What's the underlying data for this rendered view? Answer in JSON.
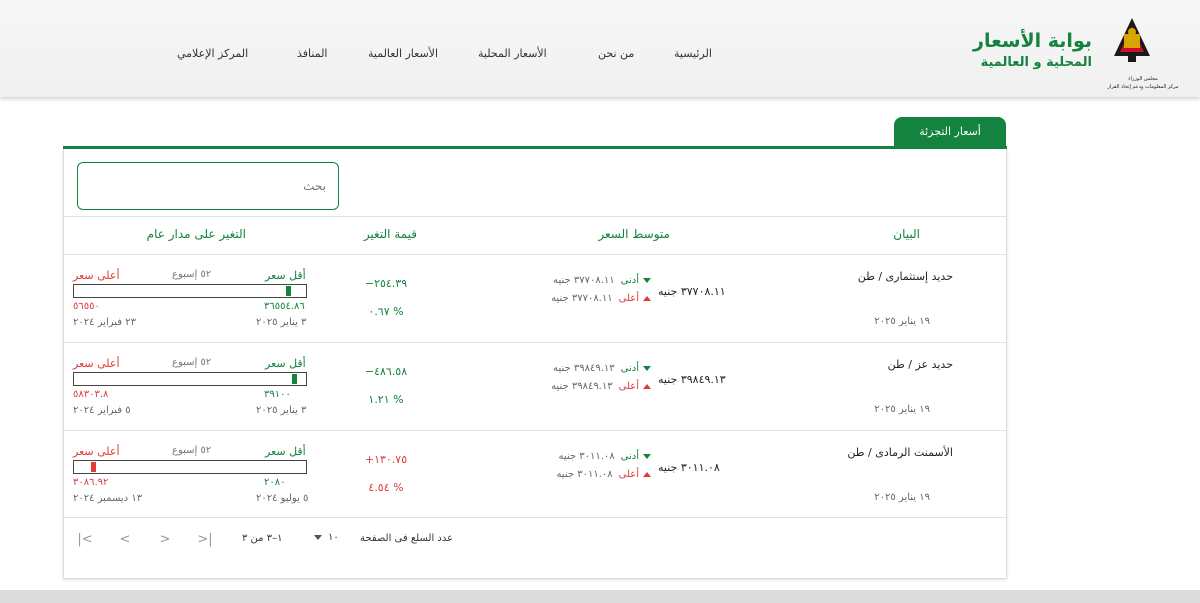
{
  "header": {
    "portal_title": "بوابة الأسعار",
    "portal_subtitle": "المحلية و العالمية",
    "logo_caption_line1": "مجلس الوزراء",
    "logo_caption_line2": "مركز المعلومات ودعم إتخاذ القرار",
    "nav": [
      "الرئيسية",
      "من نحن",
      "الأسعار المحلية",
      "الأسعار العالمية",
      "المنافذ",
      "المركز الإعلامي"
    ]
  },
  "tab": {
    "label": "أسعار التجزئة"
  },
  "search": {
    "placeholder": "بحث"
  },
  "table": {
    "headers": {
      "item": "البيان",
      "avg_price": "متوسط السعر",
      "change_value": "قيمة التغير",
      "yearly_change": "التغير على مدار عام"
    },
    "rows": [
      {
        "name": "حديد إستثمارى / طن",
        "date": "١٩ يناير ٢٠٢٥",
        "avg": "٣٧٧٠٨.١١ جنيه",
        "min_label": "أدنى",
        "min_value": "٣٧٧٠٨.١١ جنيه",
        "max_label": "أعلى",
        "max_value": "٣٧٧٠٨.١١ جنيه",
        "change": "−٢٥٤.٣٩",
        "change_pct": "٠.٦٧ %",
        "change_color": "#13833f",
        "low_label": "أقل سعر",
        "weeks": "٥٢ إسبوع",
        "high_label": "أعلى سعر",
        "low_value": "٣٦٥٥٤.٨٦",
        "high_value": "٥٦٥٥٠",
        "low_date": "٣ يناير ٢٠٢٥",
        "high_date": "٢٣ فبراير ٢٠٢٤",
        "position": 0.935,
        "marker_color": "#13833f"
      },
      {
        "name": "حديد عز / طن",
        "date": "١٩ يناير ٢٠٢٥",
        "avg": "٣٩٨٤٩.١٣ جنيه",
        "min_label": "أدنى",
        "min_value": "٣٩٨٤٩.١٣ جنيه",
        "max_label": "أعلى",
        "max_value": "٣٩٨٤٩.١٣ جنيه",
        "change": "−٤٨٦.٥٨",
        "change_pct": "١.٢١ %",
        "change_color": "#13833f",
        "low_label": "أقل سعر",
        "weeks": "٥٢ إسبوع",
        "high_label": "أعلى سعر",
        "low_value": "٣٩١٠٠",
        "high_value": "٥٨٣٠٣.٨",
        "low_date": "٣ يناير ٢٠٢٥",
        "high_date": "٥ فبراير ٢٠٢٤",
        "position": 0.96,
        "marker_color": "#13833f"
      },
      {
        "name": "الأسمنت الرمادى / طن",
        "date": "١٩ يناير ٢٠٢٥",
        "avg": "٣٠١١.٠٨ جنيه",
        "min_label": "أدنى",
        "min_value": "٣٠١١.٠٨ جنيه",
        "max_label": "أعلى",
        "max_value": "٣٠١١.٠٨ جنيه",
        "change": "+١٣٠.٧٥",
        "change_pct": "٤.٥٤ %",
        "change_color": "#e03a3a",
        "low_label": "أقل سعر",
        "weeks": "٥٢ إسبوع",
        "high_label": "أعلى سعر",
        "low_value": "٢٠٨٠",
        "high_value": "٣٠٨٦.٩٢",
        "low_date": "٥ يوليو ٢٠٢٤",
        "high_date": "١٣ ديسمبر ٢٠٢٤",
        "position": 0.075,
        "marker_color": "#e03a3a"
      }
    ]
  },
  "pagination": {
    "rows_label": "عدد السلع فى الصفحة",
    "rows_value": "١٠",
    "range": "١–٣ من ٣",
    "first": "|<",
    "prev": "<",
    "next": ">",
    "last": ">|"
  }
}
